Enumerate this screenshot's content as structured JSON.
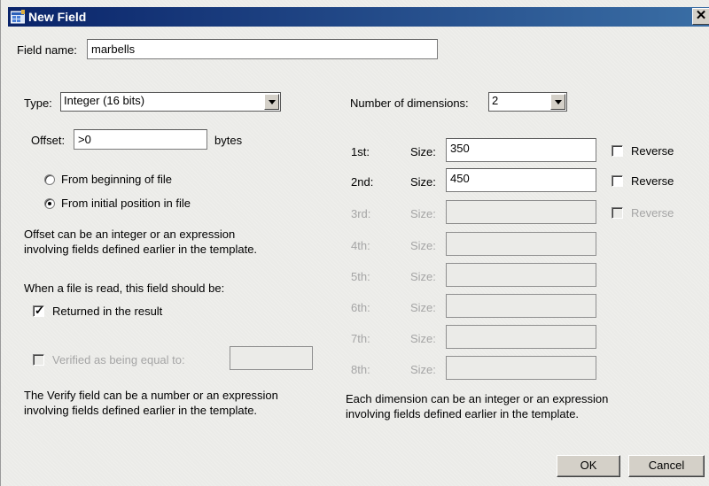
{
  "window": {
    "title": "New Field",
    "close_glyph": "✕",
    "icon": "app-grid-icon"
  },
  "field_name": {
    "label": "Field name:",
    "value": "marbells"
  },
  "type": {
    "label": "Type:",
    "value": "Integer (16 bits)"
  },
  "offset": {
    "label": "Offset:",
    "value": ">0",
    "unit": "bytes",
    "options": [
      {
        "label": "From beginning of file",
        "selected": false
      },
      {
        "label": "From initial position in file",
        "selected": true
      }
    ],
    "help_line1": "Offset can be an integer or an expression",
    "help_line2": "involving fields defined earlier in the template."
  },
  "read_behavior": {
    "heading": "When a file is read, this field should be:",
    "returned_label": "Returned in the result",
    "returned_checked": true,
    "verified_label": "Verified as being equal to:",
    "verified_checked": false,
    "verified_value": "",
    "help_line1": "The Verify field can be a number or an expression",
    "help_line2": "involving fields defined earlier in the template."
  },
  "dimensions": {
    "label": "Number of dimensions:",
    "value": "2",
    "size_label": "Size:",
    "reverse_label": "Reverse",
    "rows": [
      {
        "ordinal": "1st:",
        "size": "350",
        "enabled": true
      },
      {
        "ordinal": "2nd:",
        "size": "450",
        "enabled": true
      },
      {
        "ordinal": "3rd:",
        "size": "",
        "enabled": false
      },
      {
        "ordinal": "4th:",
        "size": "",
        "enabled": false
      },
      {
        "ordinal": "5th:",
        "size": "",
        "enabled": false
      },
      {
        "ordinal": "6th:",
        "size": "",
        "enabled": false
      },
      {
        "ordinal": "7th:",
        "size": "",
        "enabled": false
      },
      {
        "ordinal": "8th:",
        "size": "",
        "enabled": false
      }
    ],
    "help_line1": "Each dimension can be an integer or an expression",
    "help_line2": "involving fields defined earlier in the template."
  },
  "buttons": {
    "ok": "OK",
    "cancel": "Cancel"
  }
}
